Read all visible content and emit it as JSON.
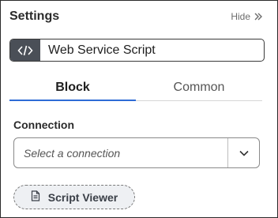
{
  "header": {
    "title": "Settings",
    "hide_label": "Hide"
  },
  "block": {
    "name": "Web Service Script",
    "icon": "code-icon"
  },
  "tabs": [
    {
      "label": "Block",
      "active": true
    },
    {
      "label": "Common",
      "active": false
    }
  ],
  "connection": {
    "label": "Connection",
    "placeholder": "Select a connection"
  },
  "script_viewer": {
    "label": "Script Viewer",
    "icon": "document-icon"
  },
  "colors": {
    "accent": "#2e6bd6",
    "icon_bg": "#4a4f57"
  }
}
